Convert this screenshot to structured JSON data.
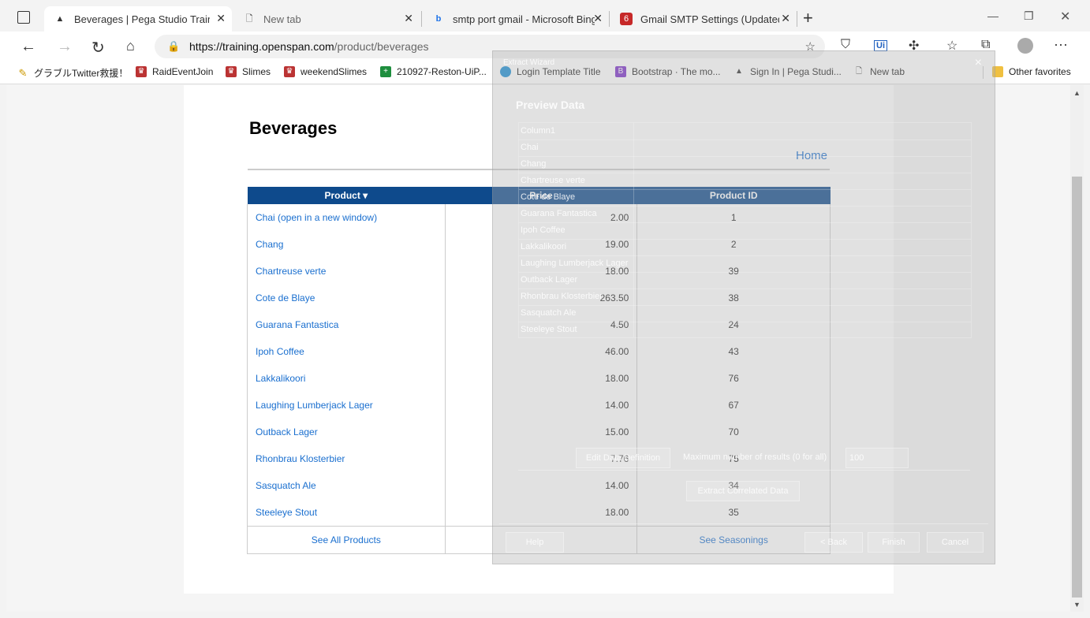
{
  "browser": {
    "tabs": [
      {
        "title": "Beverages | Pega Studio Training"
      },
      {
        "title": "New tab"
      },
      {
        "title": "smtp port gmail - Microsoft Bing"
      },
      {
        "title": "Gmail SMTP Settings (Updated C"
      }
    ],
    "url_host": "https://training.openspan.com",
    "url_path": "/product/beverages",
    "bookmarks": [
      "グラブルTwitter救援！",
      "RaidEventJoin",
      "Slimes",
      "weekendSlimes",
      "210927-Reston-UiP...",
      "Login Template Title",
      "Bootstrap · The mo...",
      "Sign In | Pega Studi...",
      "New tab",
      "Other favorites"
    ]
  },
  "page": {
    "heading": "Beverages",
    "home_link": "Home",
    "columns": [
      "Product ▾",
      "Price",
      "Product ID"
    ],
    "rows": [
      {
        "product": "Chai  (open in a new window)",
        "price": "2.00",
        "id": "1"
      },
      {
        "product": "Chang",
        "price": "19.00",
        "id": "2"
      },
      {
        "product": "Chartreuse verte",
        "price": "18.00",
        "id": "39"
      },
      {
        "product": "Cote de Blaye",
        "price": "263.50",
        "id": "38"
      },
      {
        "product": "Guarana Fantastica",
        "price": "4.50",
        "id": "24"
      },
      {
        "product": "Ipoh Coffee",
        "price": "46.00",
        "id": "43"
      },
      {
        "product": "Lakkalikoori",
        "price": "18.00",
        "id": "76"
      },
      {
        "product": "Laughing Lumberjack Lager",
        "price": "14.00",
        "id": "67"
      },
      {
        "product": "Outback Lager",
        "price": "15.00",
        "id": "70"
      },
      {
        "product": "Rhonbrau Klosterbier",
        "price": "7.76",
        "id": "75"
      },
      {
        "product": "Sasquatch Ale",
        "price": "14.00",
        "id": "34"
      },
      {
        "product": "Steeleye Stout",
        "price": "18.00",
        "id": "35"
      }
    ],
    "footer_left": "See All Products",
    "footer_right": "See Seasonings"
  },
  "overlay": {
    "title": "Extract Wizard",
    "close": "×",
    "preview_label": "Preview Data",
    "column_header": "Column1",
    "items": [
      "Chai",
      "Chang",
      "Chartreuse verte",
      "Cote de Blaye",
      "Guarana Fantastica",
      "Ipoh Coffee",
      "Lakkalikoori",
      "Laughing Lumberjack Lager",
      "Outback Lager",
      "Rhonbrau Klosterbier",
      "Sasquatch Ale",
      "Steeleye Stout"
    ],
    "edit_button": "Edit Data Definition",
    "max_label": "Maximum number of results (0 for all)",
    "max_value": "100",
    "extract_button": "Extract Correlated Data",
    "help_button": "Help",
    "back_button": "< Back",
    "finish_button": "Finish",
    "cancel_button": "Cancel"
  }
}
